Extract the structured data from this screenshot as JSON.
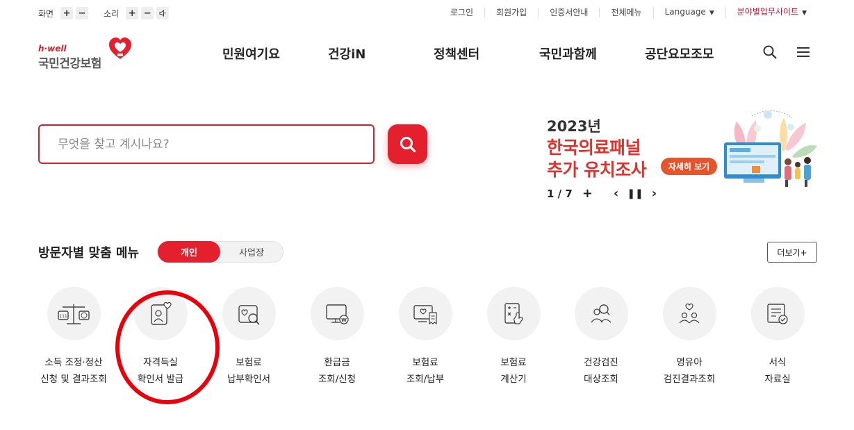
{
  "util": {
    "screen_label": "화면",
    "sound_label": "소리",
    "links": [
      "로그인",
      "회원가입",
      "인증서안내",
      "전체메뉴"
    ],
    "language_label": "Language",
    "sites_label": "분야별업무사이트"
  },
  "logo": {
    "tagline": "h·well",
    "name": "국민건강보험"
  },
  "gnb": [
    "민원여기요",
    "건강iN",
    "정책센터",
    "국민과함께",
    "공단요모조모"
  ],
  "search": {
    "placeholder": "무엇을 찾고 계시나요?"
  },
  "banner": {
    "year": "2023년",
    "line1": "한국의료패널",
    "line2": "추가 유치조사",
    "button_label": "자세히 보기",
    "current": "1",
    "total": "7"
  },
  "section": {
    "title": "방문자별 맞춤 메뉴",
    "tab_active": "개인",
    "tab_inactive": "사업장",
    "more_label": "더보기+"
  },
  "quick_menu": [
    {
      "line1": "소득 조정·정산",
      "line2": "신청 및 결과조회",
      "icon": "scale-icon"
    },
    {
      "line1": "자격득실",
      "line2": "확인서 발급",
      "icon": "id-card-heart-icon"
    },
    {
      "line1": "보험료",
      "line2": "납부확인서",
      "icon": "heart-search-icon"
    },
    {
      "line1": "환급금",
      "line2": "조회/신청",
      "icon": "monitor-won-icon"
    },
    {
      "line1": "보험료",
      "line2": "조회/납부",
      "icon": "monitor-receipt-icon"
    },
    {
      "line1": "보험료",
      "line2": "계산기",
      "icon": "calculator-icon"
    },
    {
      "line1": "건강검진",
      "line2": "대상조회",
      "icon": "people-search-icon"
    },
    {
      "line1": "영유아",
      "line2": "검진결과조회",
      "icon": "family-heart-icon"
    },
    {
      "line1": "서식",
      "line2": "자료실",
      "icon": "document-check-icon"
    }
  ],
  "colors": {
    "brand_red": "#e5202e",
    "banner_red": "#e0322d",
    "annotation": "#e8000b"
  }
}
